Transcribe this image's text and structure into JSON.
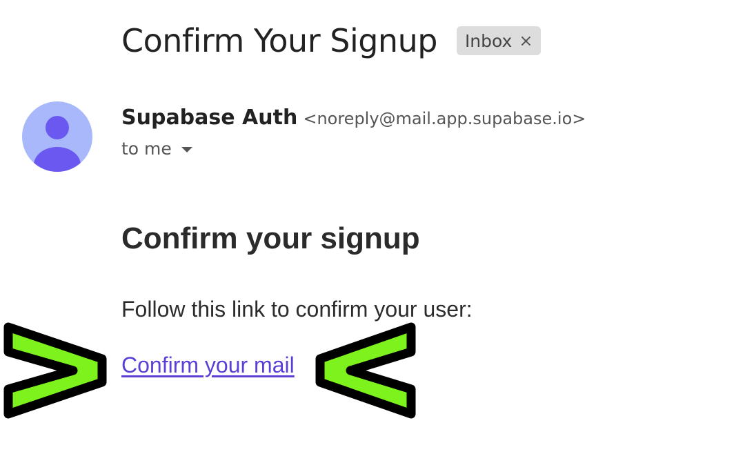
{
  "email": {
    "subject": "Confirm Your Signup",
    "label_chip": {
      "text": "Inbox",
      "close_glyph": "×"
    },
    "sender": {
      "name": "Supabase Auth",
      "address": "<noreply@mail.app.supabase.io>",
      "avatar_icon": "person-icon"
    },
    "recipient": {
      "text": "to me",
      "icon": "caret-down-icon"
    },
    "body": {
      "heading": "Confirm your signup",
      "instruction": "Follow this link to confirm your user:",
      "link_text": "Confirm your mail"
    }
  },
  "annotations": {
    "left_marker_icon": "greater-than-arrow-icon",
    "right_marker_icon": "less-than-arrow-icon"
  },
  "colors": {
    "link": "#5b3fd6",
    "marker_fill": "#7df21c",
    "marker_outline": "#000000",
    "avatar_bg": "#a8b8fb",
    "avatar_figure": "#6a58f0",
    "chip_bg": "#dddddd"
  }
}
